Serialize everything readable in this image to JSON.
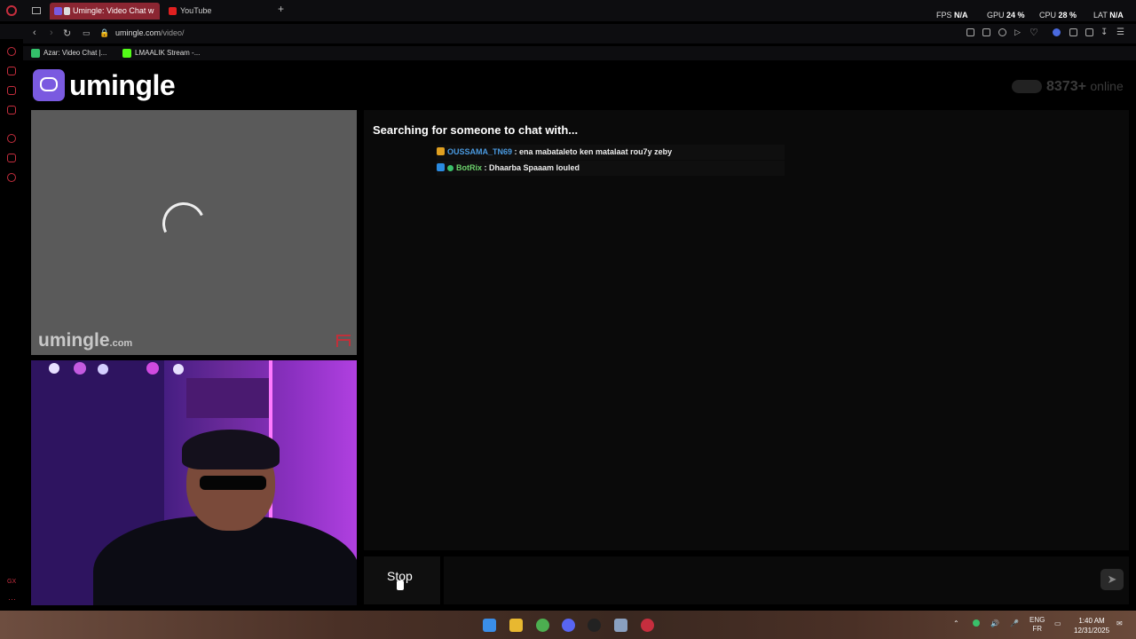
{
  "browser": {
    "tabs": [
      {
        "label": "Umingle: Video Chat w",
        "active": true
      },
      {
        "label": "YouTube",
        "active": false
      }
    ],
    "new_tab": "+",
    "stats": {
      "fps_label": "FPS",
      "fps": "N/A",
      "gpu_label": "GPU",
      "gpu": "24 %",
      "cpu_label": "CPU",
      "cpu": "28 %",
      "lat_label": "LAT",
      "lat": "N/A"
    },
    "url_host": "umingle.com",
    "url_path": "/video/",
    "bookmarks": [
      {
        "label": "Azar: Video Chat |..."
      },
      {
        "label": "LMAALIK Stream -..."
      }
    ],
    "sidebar_bottom": "GX"
  },
  "site": {
    "logo": "umingle",
    "online_count": "8373+",
    "online_label": "online",
    "watermark": "umingle",
    "watermark_suffix": ".com"
  },
  "chat": {
    "status": "Searching for someone to chat with...",
    "overlay": [
      {
        "user": "OUSSAMA_TN69",
        "text": " : ena mabataleto ken matalaat rou7y zeby"
      },
      {
        "user": "BotRix",
        "text": " : Dhaarba Spaaam louled"
      }
    ],
    "stop_label": "Stop",
    "send_icon": "send-icon"
  },
  "taskbar": {
    "lang": "ENG",
    "lang_sub": "FR",
    "time": "1:40 AM",
    "date": "12/31/2025"
  },
  "colors": {
    "accent": "#7a5ae0",
    "gx_red": "#c62e3e",
    "tab_active": "#8b2632"
  }
}
